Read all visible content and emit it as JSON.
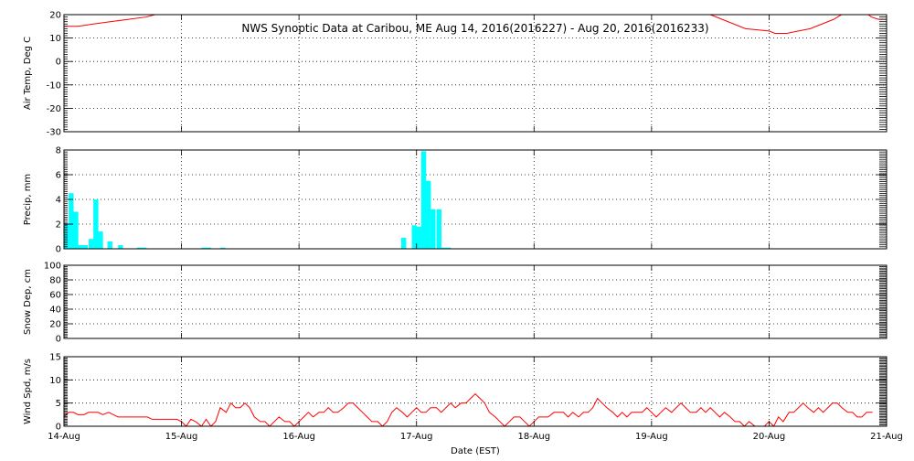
{
  "chart_data": {
    "type": "line",
    "title": "NWS Synoptic Data at Caribou, ME   Aug 14, 2016(2016227) - Aug 20, 2016(2016233)",
    "xlabel": "Date (EST)",
    "x_ticks": [
      "14-Aug",
      "15-Aug",
      "16-Aug",
      "17-Aug",
      "18-Aug",
      "19-Aug",
      "20-Aug",
      "21-Aug"
    ],
    "xlim": [
      0,
      7
    ],
    "grid": true,
    "panels": [
      {
        "type": "line",
        "ylabel": "Air Temp, Deg C",
        "ylim": [
          -30,
          20
        ],
        "yticks": [
          -30,
          -20,
          -10,
          0,
          10,
          20
        ],
        "color": "#ff0000",
        "series": [
          {
            "x": [
              0.0,
              0.12,
              0.25,
              0.4,
              0.55,
              0.7,
              0.85,
              1.0,
              1.1,
              1.2,
              1.3,
              1.45,
              1.6,
              1.8,
              2.0,
              2.2,
              2.4,
              2.6,
              2.8,
              3.0,
              3.2,
              3.4,
              3.6,
              3.8,
              4.0,
              4.2,
              4.4,
              4.6,
              4.8,
              5.0,
              5.2,
              5.4,
              5.5,
              5.6,
              5.8,
              6.0,
              6.05,
              6.15,
              6.25,
              6.35,
              6.45,
              6.55,
              6.65,
              6.75,
              6.82,
              6.87,
              6.93,
              7.0
            ],
            "y": [
              15,
              15,
              16,
              17,
              18,
              19,
              21,
              24,
              25,
              24,
              22,
              21,
              22,
              24,
              25,
              24,
              23,
              22,
              21,
              22,
              23,
              21,
              22,
              23,
              24,
              25,
              26,
              25,
              24,
              23,
              22,
              21,
              20,
              18,
              14,
              13,
              12,
              12,
              13,
              14,
              16,
              18,
              21,
              23,
              21,
              19,
              18,
              18
            ]
          }
        ]
      },
      {
        "type": "bar",
        "ylabel": "Precip, mm",
        "ylim": [
          0,
          8
        ],
        "yticks": [
          0,
          2,
          4,
          6,
          8
        ],
        "color": "#00ffff",
        "bar_width": 0.042,
        "x": [
          0.0,
          0.04,
          0.08,
          0.12,
          0.16,
          0.21,
          0.25,
          0.29,
          0.37,
          0.46,
          0.62,
          0.66,
          1.17,
          1.21,
          1.33,
          2.87,
          2.96,
          3.0,
          3.04,
          3.08,
          3.12,
          3.17,
          3.21,
          3.25
        ],
        "values": [
          2.0,
          4.5,
          3.0,
          0.3,
          0.3,
          0.8,
          4.0,
          1.4,
          0.6,
          0.3,
          0.1,
          0.1,
          0.1,
          0.1,
          0.1,
          0.9,
          1.9,
          1.8,
          7.9,
          5.5,
          3.2,
          3.2,
          0.1,
          0.1
        ]
      },
      {
        "type": "line",
        "ylabel": "Snow Dep, cm",
        "ylim": [
          0,
          100
        ],
        "yticks": [
          0,
          20,
          40,
          60,
          80,
          100
        ],
        "color": "#ff0000",
        "series": []
      },
      {
        "type": "line",
        "ylabel": "Wind Spd, m/s",
        "ylim": [
          0,
          15
        ],
        "yticks": [
          0,
          5,
          10,
          15
        ],
        "color": "#ff0000",
        "series": [
          {
            "x": [
              0.0,
              0.04,
              0.08,
              0.12,
              0.17,
              0.21,
              0.25,
              0.29,
              0.33,
              0.38,
              0.42,
              0.46,
              0.5,
              0.54,
              0.58,
              0.62,
              0.67,
              0.71,
              0.75,
              0.79,
              0.83,
              0.88,
              0.92,
              0.96,
              1.0,
              1.04,
              1.08,
              1.12,
              1.17,
              1.21,
              1.25,
              1.29,
              1.33,
              1.38,
              1.42,
              1.46,
              1.5,
              1.54,
              1.58,
              1.62,
              1.67,
              1.71,
              1.75,
              1.79,
              1.83,
              1.88,
              1.92,
              1.96,
              2.0,
              2.04,
              2.08,
              2.12,
              2.17,
              2.21,
              2.25,
              2.29,
              2.33,
              2.38,
              2.42,
              2.46,
              2.5,
              2.54,
              2.58,
              2.62,
              2.67,
              2.71,
              2.75,
              2.79,
              2.83,
              2.88,
              2.92,
              2.96,
              3.0,
              3.04,
              3.08,
              3.12,
              3.17,
              3.21,
              3.25,
              3.29,
              3.33,
              3.38,
              3.42,
              3.46,
              3.5,
              3.54,
              3.58,
              3.62,
              3.67,
              3.71,
              3.75,
              3.79,
              3.83,
              3.88,
              3.92,
              3.96,
              4.0,
              4.04,
              4.08,
              4.12,
              4.17,
              4.21,
              4.25,
              4.29,
              4.33,
              4.38,
              4.42,
              4.46,
              4.5,
              4.54,
              4.58,
              4.62,
              4.67,
              4.71,
              4.75,
              4.79,
              4.83,
              4.88,
              4.92,
              4.96,
              5.0,
              5.04,
              5.08,
              5.12,
              5.17,
              5.21,
              5.25,
              5.29,
              5.33,
              5.38,
              5.42,
              5.46,
              5.5,
              5.54,
              5.58,
              5.62,
              5.67,
              5.71,
              5.75,
              5.79,
              5.83,
              5.88,
              5.92,
              5.96,
              6.0,
              6.04,
              6.08,
              6.12,
              6.17,
              6.21,
              6.25,
              6.29,
              6.33,
              6.38,
              6.42,
              6.46,
              6.5,
              6.54,
              6.58,
              6.62,
              6.67,
              6.71,
              6.75,
              6.79,
              6.83,
              6.88,
              6.92,
              6.96,
              7.0
            ],
            "y": [
              2,
              3,
              3,
              2.5,
              2.5,
              3,
              3,
              3,
              2.5,
              3,
              2.5,
              2,
              2,
              2,
              2,
              2,
              2,
              2,
              1.5,
              1.5,
              1.5,
              1.5,
              1.5,
              1.5,
              1,
              0,
              1.5,
              1,
              0,
              1.5,
              0,
              1,
              4,
              3,
              5,
              4,
              4,
              5,
              4,
              2,
              1,
              1,
              0,
              1,
              2,
              1,
              1,
              0,
              1,
              2,
              3,
              2,
              3,
              3,
              4,
              3,
              3,
              4,
              5,
              5,
              4,
              3,
              2,
              1,
              1,
              0,
              1,
              3,
              4,
              3,
              2,
              3,
              4,
              3,
              3,
              4,
              4,
              3,
              4,
              5,
              4,
              5,
              5,
              6,
              7,
              6,
              5,
              3,
              2,
              1,
              0,
              1,
              2,
              2,
              1,
              0,
              1,
              2,
              2,
              2,
              3,
              3,
              3,
              2,
              3,
              2,
              3,
              3,
              4,
              6,
              5,
              4,
              3,
              2,
              3,
              2,
              3,
              3,
              3,
              4,
              3,
              2,
              3,
              4,
              3,
              4,
              5,
              4,
              3,
              3,
              4,
              3,
              4,
              3,
              2,
              3,
              2,
              1,
              1,
              0,
              1,
              0,
              0,
              0,
              1,
              0,
              2,
              1,
              3,
              3,
              4,
              5,
              4,
              3,
              4,
              3,
              4,
              5,
              5,
              4,
              3,
              3,
              2,
              2,
              3,
              3
            ]
          }
        ]
      }
    ]
  }
}
